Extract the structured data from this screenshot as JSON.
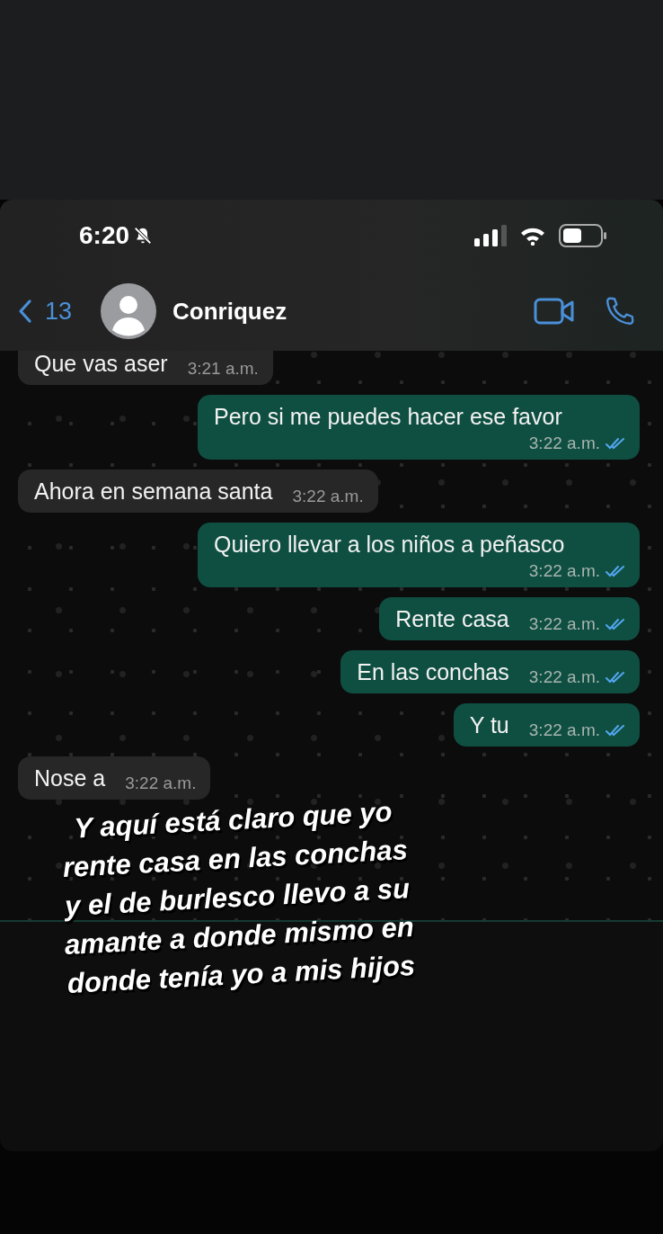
{
  "status_bar": {
    "time": "6:20",
    "muted": true
  },
  "header": {
    "back_count": "13",
    "contact": "Conriquez"
  },
  "messages": [
    {
      "kind": "in",
      "text": "Que vas aser",
      "time": "3:21 a.m."
    },
    {
      "kind": "out",
      "text": "Pero si me puedes hacer ese favor",
      "time": "3:22 a.m.",
      "read": true
    },
    {
      "kind": "in",
      "text": "Ahora en semana santa",
      "time": "3:22 a.m."
    },
    {
      "kind": "out",
      "text": "Quiero llevar a los niños a peñasco",
      "time": "3:22 a.m.",
      "read": true
    },
    {
      "kind": "out",
      "text": "Rente casa",
      "time": "3:22 a.m.",
      "read": true
    },
    {
      "kind": "out",
      "text": "En las conchas",
      "time": "3:22 a.m.",
      "read": true
    },
    {
      "kind": "out",
      "text": "Y tu",
      "time": "3:22 a.m.",
      "read": true
    },
    {
      "kind": "in",
      "text": "Nose a",
      "time": "3:22 a.m."
    }
  ],
  "caption": "Y aquí está claro que yo rente casa en las conchas y el de burlesco llevo a su amante a donde mismo en donde tenía yo a mis hijos"
}
